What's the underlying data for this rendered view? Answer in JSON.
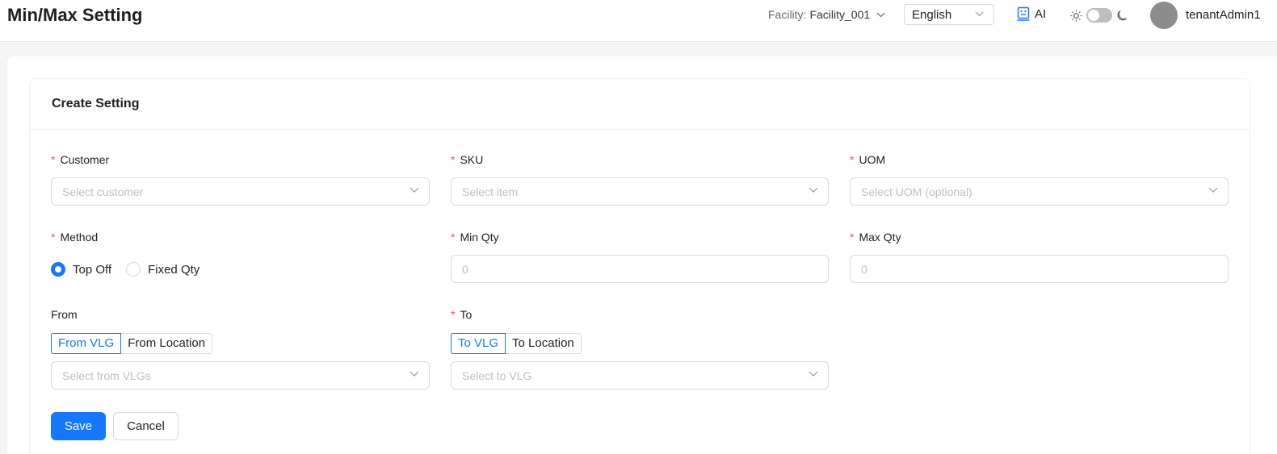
{
  "header": {
    "title": "Min/Max Setting",
    "facility_label": "Facility:",
    "facility_value": "Facility_001",
    "language": "English",
    "ai_label": "AI",
    "username": "tenantAdmin1"
  },
  "card": {
    "title": "Create Setting"
  },
  "form": {
    "customer": {
      "label": "Customer",
      "placeholder": "Select customer"
    },
    "sku": {
      "label": "SKU",
      "placeholder": "Select item"
    },
    "uom": {
      "label": "UOM",
      "placeholder": "Select UOM (optional)"
    },
    "method": {
      "label": "Method",
      "options": [
        "Top Off",
        "Fixed Qty"
      ],
      "selected": "Top Off"
    },
    "min_qty": {
      "label": "Min Qty",
      "placeholder": "0"
    },
    "max_qty": {
      "label": "Max Qty",
      "placeholder": "0"
    },
    "from": {
      "label": "From",
      "options": [
        "From VLG",
        "From Location"
      ],
      "selected": "From VLG",
      "placeholder": "Select from VLGs"
    },
    "to": {
      "label": "To",
      "options": [
        "To VLG",
        "To Location"
      ],
      "selected": "To VLG",
      "placeholder": "Select to VLG"
    }
  },
  "actions": {
    "save": "Save",
    "cancel": "Cancel"
  },
  "colors": {
    "primary": "#1677ff",
    "required": "#ff4d4f",
    "border": "#d9d9d9",
    "placeholder": "#bfbfbf"
  }
}
